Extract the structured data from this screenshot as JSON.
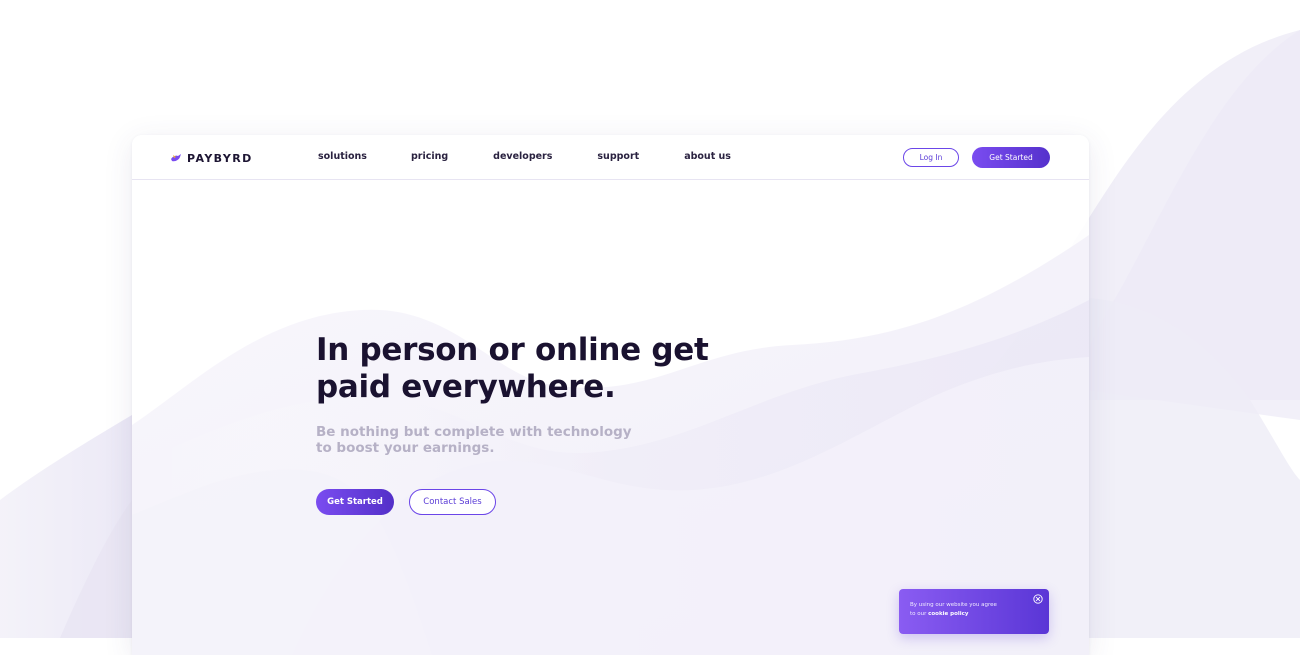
{
  "brand": {
    "name": "PAYBYRD",
    "logo_icon": "bird-icon",
    "accent_color": "#6b46e8",
    "accent_dark": "#5330c8"
  },
  "nav": {
    "links": [
      "solutions",
      "pricing",
      "developers",
      "support",
      "about us"
    ],
    "login_label": "Log In",
    "get_started_label": "Get Started"
  },
  "hero": {
    "title_line1": "In person or online get",
    "title_line2": "paid everywhere.",
    "subtitle_line1": "Be nothing but complete with technology",
    "subtitle_line2": "to boost your earnings.",
    "primary_button": "Get Started",
    "secondary_button": "Contact Sales"
  },
  "cookie": {
    "text_line1": "By using our website you agree",
    "text_prefix": "to our",
    "link_text": "cookie policy",
    "close_icon": "close-circle-icon"
  }
}
